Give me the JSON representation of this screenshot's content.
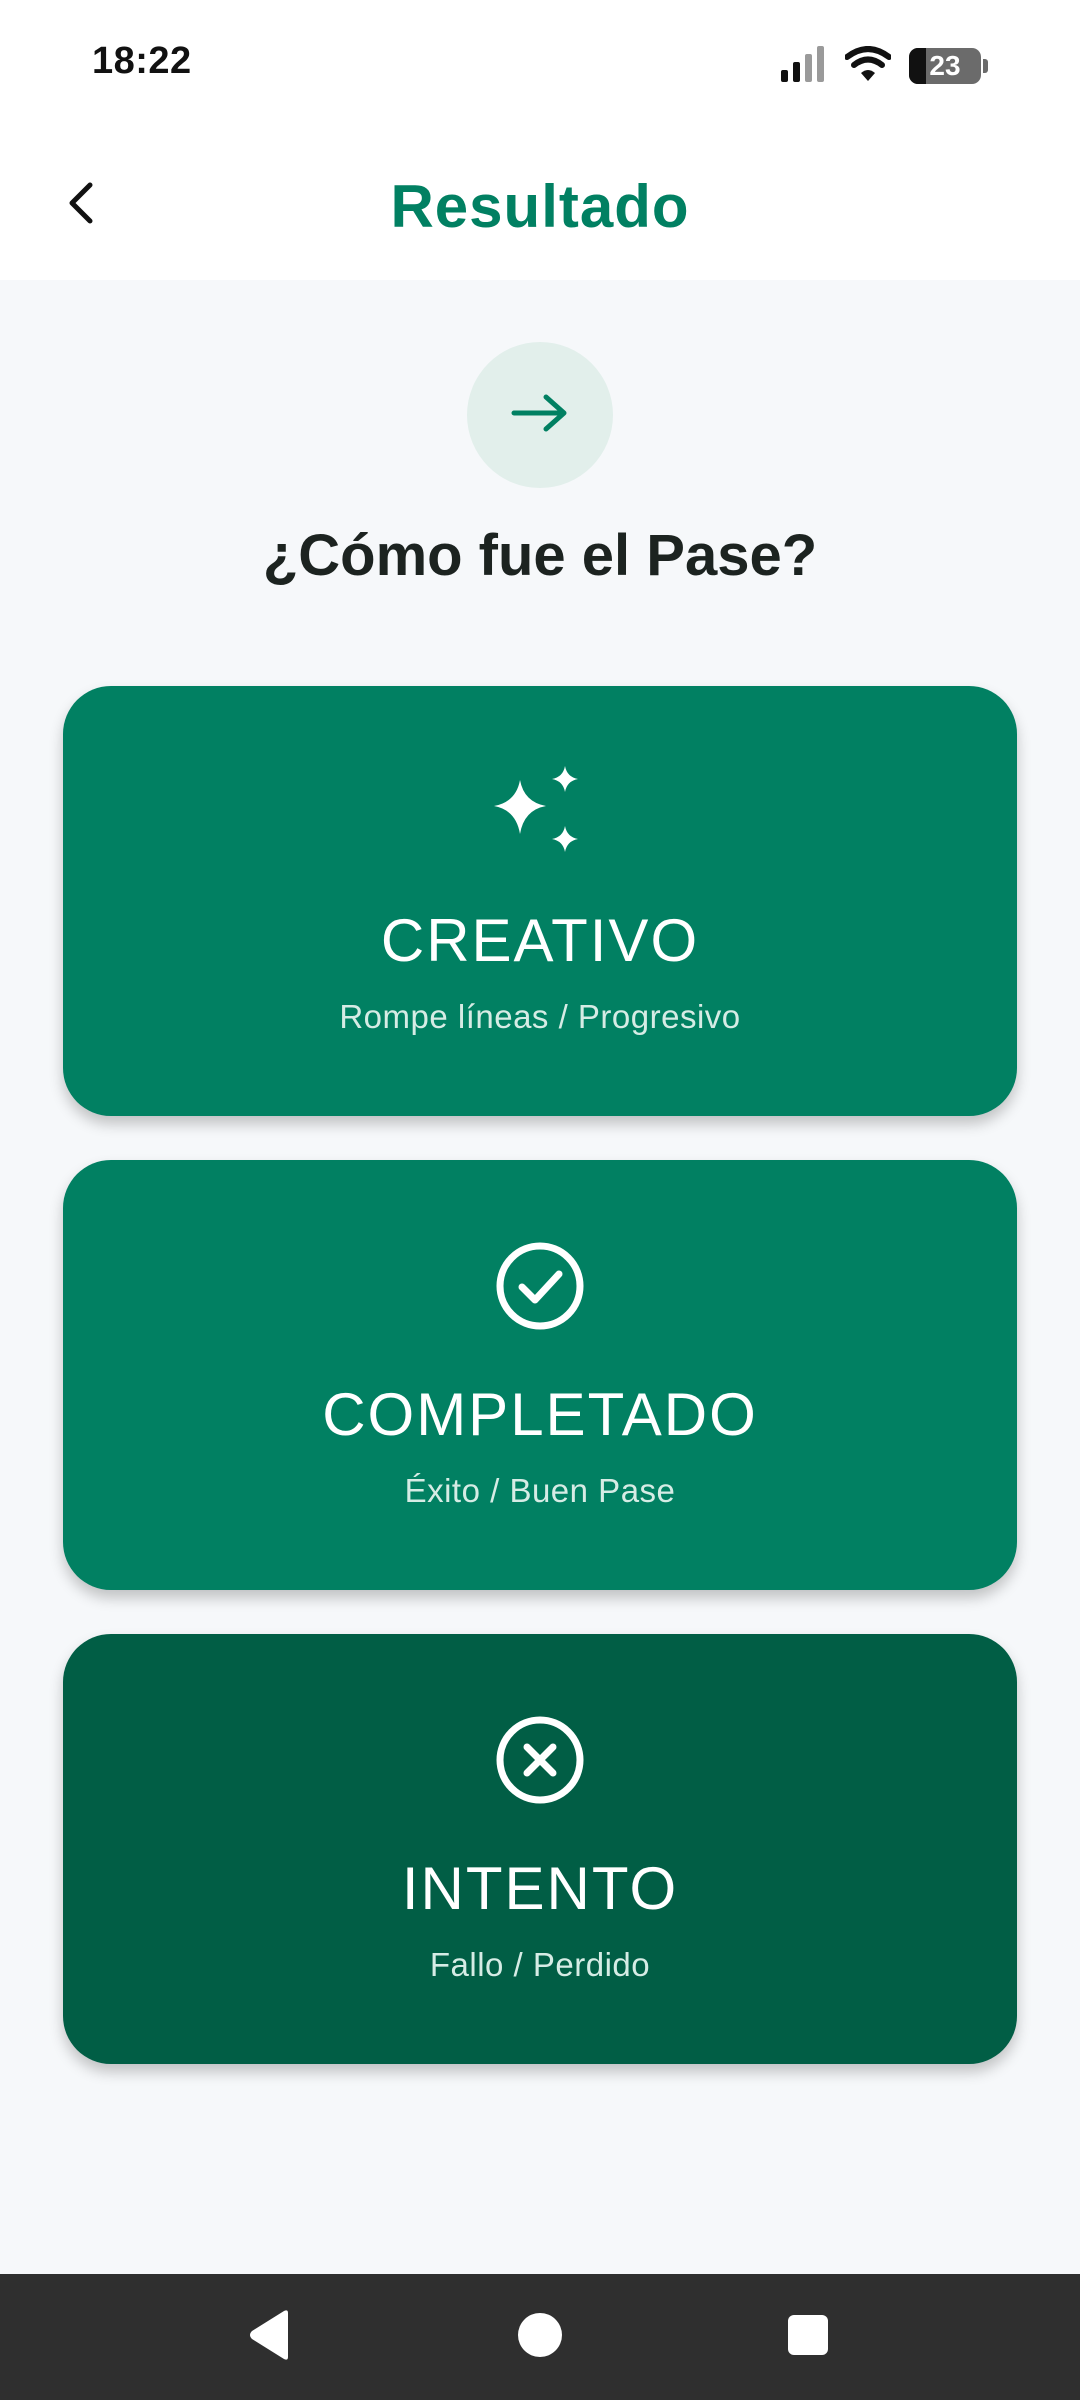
{
  "status_bar": {
    "time": "18:22",
    "battery_level": "23"
  },
  "app_bar": {
    "title": "Resultado",
    "back_icon": "chevron-left-icon"
  },
  "header": {
    "icon": "arrow-right-icon",
    "question": "¿Cómo fue el Pase?"
  },
  "options": [
    {
      "title": "CREATIVO",
      "subtitle": "Rompe líneas / Progresivo",
      "icon": "sparkles-icon",
      "color": "#018062"
    },
    {
      "title": "COMPLETADO",
      "subtitle": "Éxito / Buen Pase",
      "icon": "check-circle-icon",
      "color": "#018062"
    },
    {
      "title": "INTENTO",
      "subtitle": "Fallo / Perdido",
      "icon": "x-circle-icon",
      "color": "#015e45"
    }
  ],
  "colors": {
    "accent": "#018062",
    "accent_dark": "#015e45",
    "icon_circle": "#e2efeb",
    "background": "#f6f8fa"
  }
}
